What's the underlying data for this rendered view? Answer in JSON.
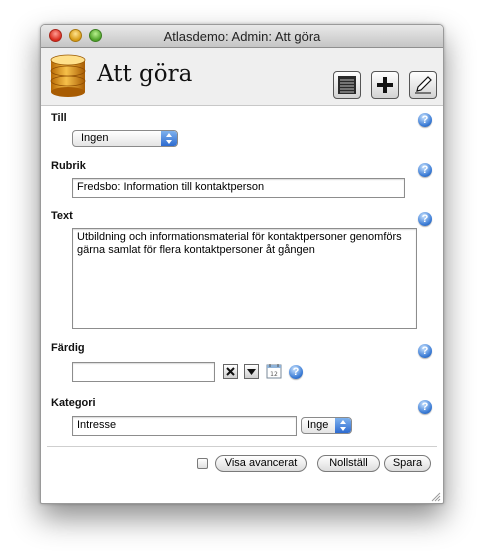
{
  "window": {
    "title": "Atlasdemo: Admin: Att göra"
  },
  "header": {
    "title": "Att göra"
  },
  "toolbar": {
    "icons": [
      "list-icon",
      "plus-icon",
      "pencil-icon"
    ]
  },
  "form": {
    "till": {
      "label": "Till",
      "value": "Ingen"
    },
    "rubrik": {
      "label": "Rubrik",
      "value": "Fredsbo: Information till kontaktperson"
    },
    "text": {
      "label": "Text",
      "value": "Utbildning och informationsmaterial för kontaktpersoner genomförs gärna samlat för flera kontaktpersoner åt gången"
    },
    "fardig": {
      "label": "Färdig",
      "value": ""
    },
    "kategori": {
      "label": "Kategori",
      "value": "Intresse",
      "select_value": "Inge"
    }
  },
  "footer": {
    "advanced_label": "Visa avancerat",
    "reset_label": "Nollställ",
    "save_label": "Spara"
  },
  "help": {
    "glyph": "?"
  },
  "colors": {
    "accent": "#3a7bd5"
  }
}
